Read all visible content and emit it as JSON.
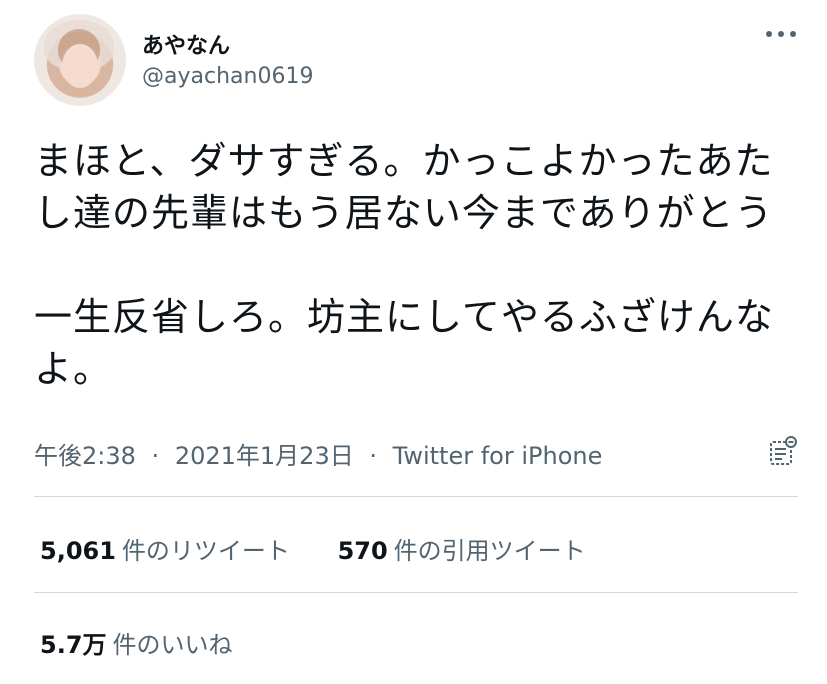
{
  "user": {
    "display_name": "あやなん",
    "handle": "@ayachan0619"
  },
  "tweet": {
    "text": "まほと、ダサすぎる。かっこよかったあたし達の先輩はもう居ない今までありがとう\n\n一生反省しろ。坊主にしてやるふざけんなよ。",
    "time": "午後2:38",
    "date": "2021年1月23日",
    "source": "Twitter for iPhone",
    "separator": "·"
  },
  "stats": {
    "retweets_count": "5,061",
    "retweets_label": "件のリツイート",
    "quotes_count": "570",
    "quotes_label": "件の引用ツイート",
    "likes_count": "5.7万",
    "likes_label": "件のいいね"
  },
  "icons": {
    "more": "more-horizontal-icon",
    "analytics": "analytics-icon"
  }
}
